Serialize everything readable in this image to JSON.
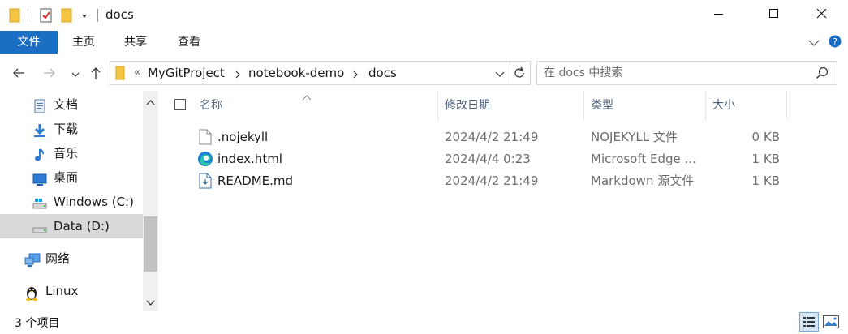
{
  "window": {
    "title": "docs",
    "minimize_icon": "minimize-icon",
    "maximize_icon": "maximize-icon",
    "close_icon": "close-icon"
  },
  "ribbon": {
    "tabs": [
      {
        "label": "文件"
      },
      {
        "label": "主页"
      },
      {
        "label": "共享"
      },
      {
        "label": "查看"
      }
    ]
  },
  "address": {
    "overflow": "«",
    "breadcrumbs": [
      "MyGitProject",
      "notebook-demo",
      "docs"
    ],
    "search_placeholder": "在 docs 中搜索"
  },
  "nav": {
    "items": [
      {
        "label": "文档",
        "icon": "documents-icon"
      },
      {
        "label": "下载",
        "icon": "downloads-icon"
      },
      {
        "label": "音乐",
        "icon": "music-icon"
      },
      {
        "label": "桌面",
        "icon": "desktop-icon"
      },
      {
        "label": "Windows (C:)",
        "icon": "drive-c-icon"
      },
      {
        "label": "Data (D:)",
        "icon": "drive-d-icon"
      },
      {
        "label": "网络",
        "icon": "network-icon"
      },
      {
        "label": "Linux",
        "icon": "linux-icon"
      }
    ]
  },
  "list": {
    "columns": {
      "name": "名称",
      "date": "修改日期",
      "type": "类型",
      "size": "大小"
    },
    "files": [
      {
        "name": ".nojekyll",
        "date": "2024/4/2 21:49",
        "type": "NOJEKYLL 文件",
        "size": "0 KB",
        "icon": "blank-file-icon"
      },
      {
        "name": "index.html",
        "date": "2024/4/4 0:23",
        "type": "Microsoft Edge ...",
        "size": "1 KB",
        "icon": "edge-icon"
      },
      {
        "name": "README.md",
        "date": "2024/4/2 21:49",
        "type": "Markdown 源文件",
        "size": "1 KB",
        "icon": "markdown-file-icon"
      }
    ]
  },
  "status": {
    "count": "3 个项目"
  },
  "colors": {
    "accent": "#1a6fc4",
    "folder": "#f4c542",
    "selected": "#d9d9d9"
  }
}
